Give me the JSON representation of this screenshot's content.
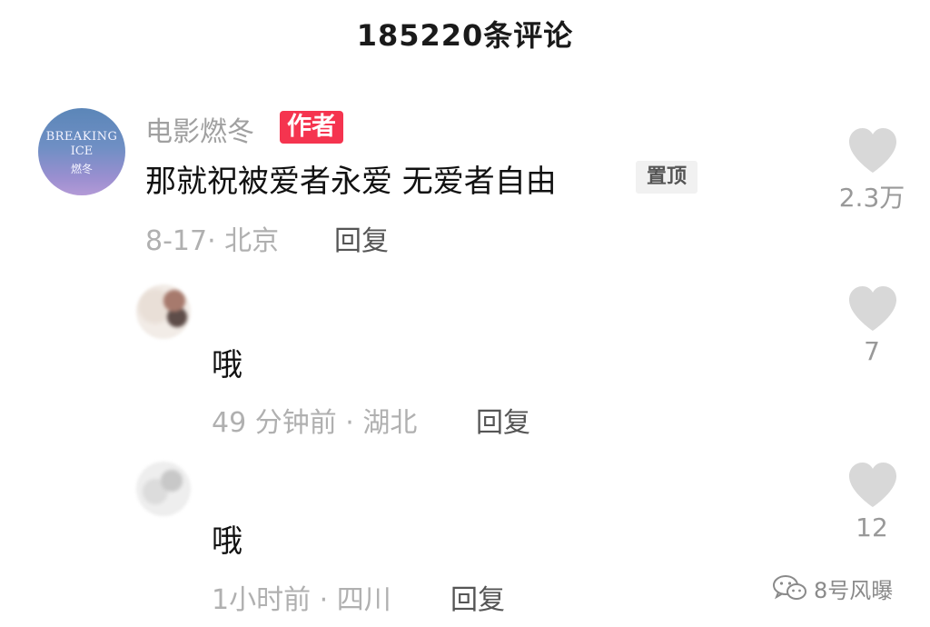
{
  "header": {
    "title": "185220条评论"
  },
  "main_comment": {
    "avatar_text": {
      "line1": "BREAKING",
      "line2": "ICE",
      "line3": "燃冬"
    },
    "username": "电影燃冬",
    "author_badge": "作者",
    "text": "那就祝被爱者永爱 无爱者自由",
    "pinned_badge": "置顶",
    "meta": "8-17· 北京",
    "reply_label": "回复",
    "likes": "2.3万"
  },
  "replies": [
    {
      "text": "哦",
      "meta": "49 分钟前 · 湖北",
      "reply_label": "回复",
      "likes": "7"
    },
    {
      "text": "哦",
      "meta": "1小时前 · 四川",
      "reply_label": "回复",
      "likes": "12"
    }
  ],
  "watermark": {
    "text": "8号风曝",
    "icon": "wechat-icon"
  },
  "colors": {
    "author_badge_bg": "#f5344f",
    "heart": "#d8d8d8",
    "meta_text": "#b0b0b0"
  },
  "icons": {
    "like": "heart-icon"
  }
}
